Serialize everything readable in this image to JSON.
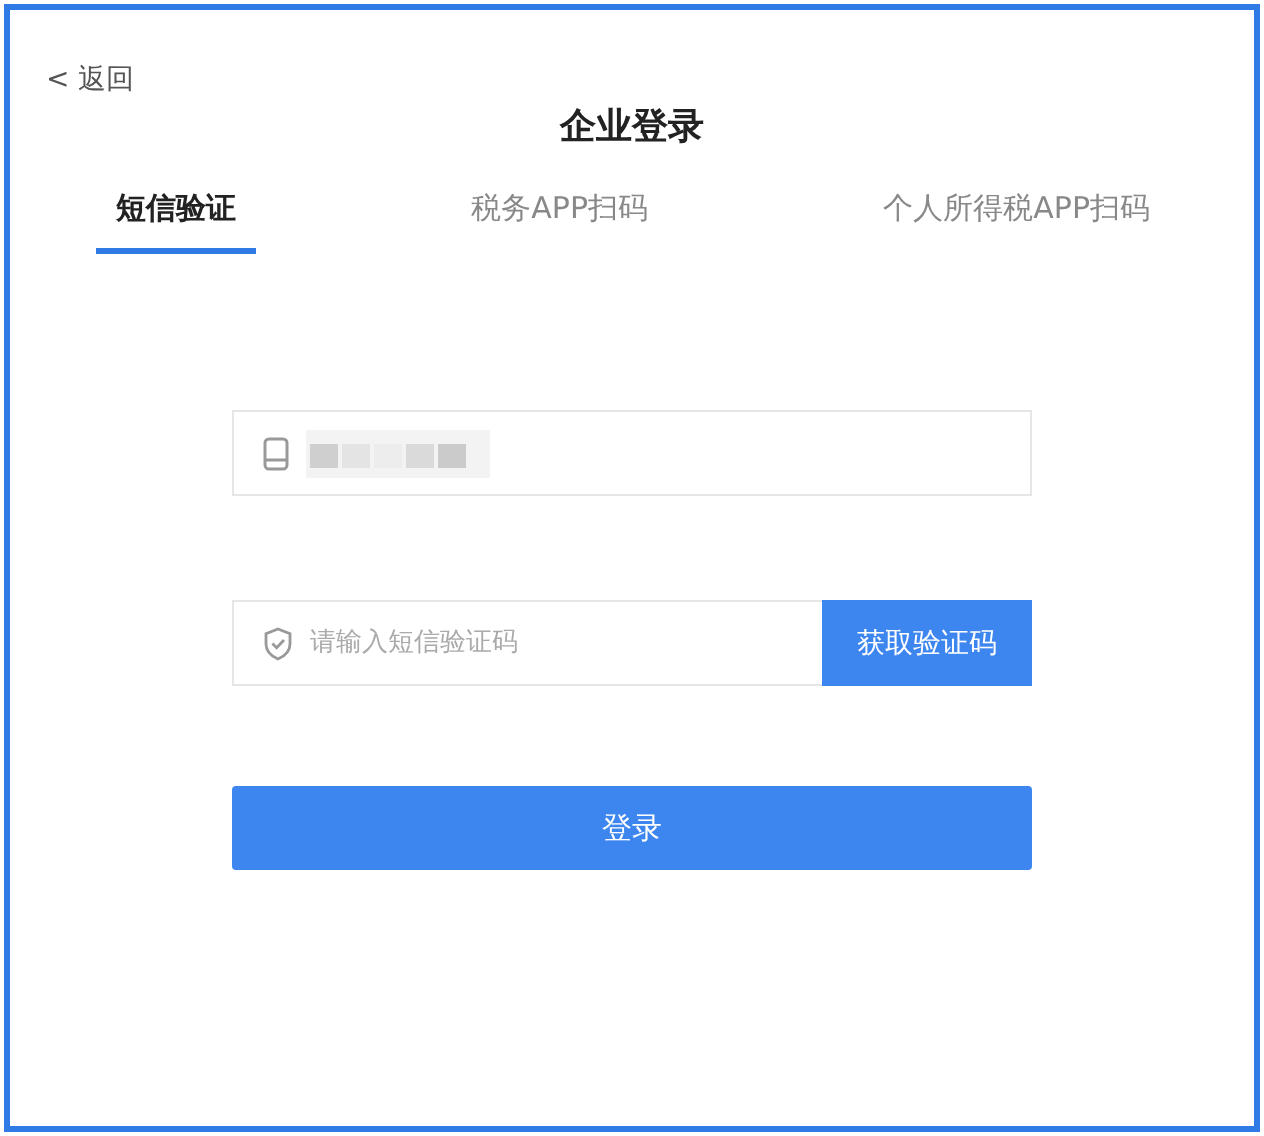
{
  "back_link": {
    "icon": "<",
    "label": "返回"
  },
  "title": "企业登录",
  "tabs": [
    {
      "label": "短信验证",
      "selected": true
    },
    {
      "label": "税务APP扫码",
      "selected": false
    },
    {
      "label": "个人所得税APP扫码",
      "selected": false
    }
  ],
  "phone_field": {
    "redacted": true
  },
  "code_field": {
    "placeholder": "请输入短信验证码"
  },
  "get_code_button": "获取验证码",
  "login_button": "登录"
}
